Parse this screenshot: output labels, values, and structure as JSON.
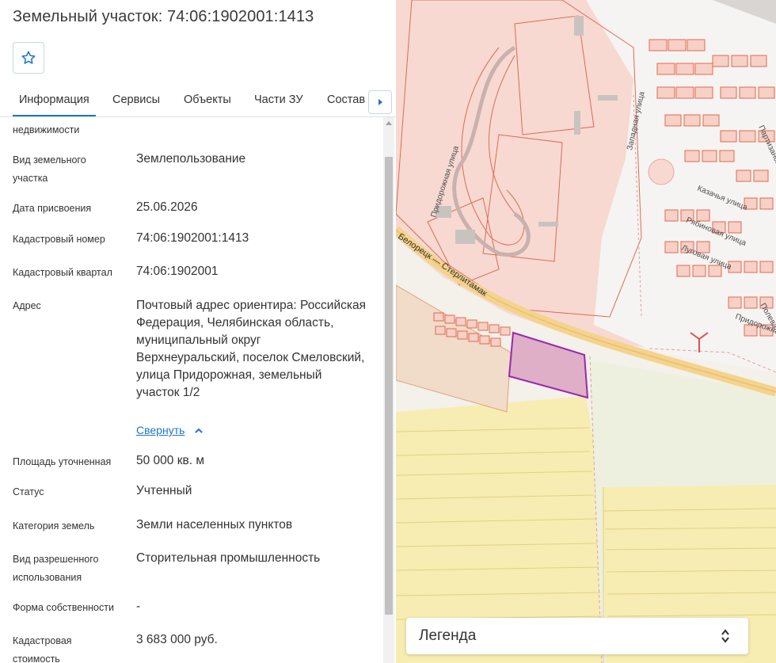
{
  "panel": {
    "title": "Земельный участок: 74:06:1902001:1413",
    "favorite_icon": "star-outline-icon",
    "tabs": [
      "Информация",
      "Сервисы",
      "Объекты",
      "Части ЗУ",
      "Состав"
    ],
    "active_tab": "Информация",
    "tab_scroll_icon": "chevron-right-icon",
    "rows": [
      {
        "label": "недвижимости",
        "value": ""
      },
      {
        "label": "Вид земельного участка",
        "value": "Землепользование"
      },
      {
        "label": "Дата присвоения",
        "value": "25.06.2026"
      },
      {
        "label": "Кадастровый номер",
        "value": "74:06:1902001:1413"
      },
      {
        "label": "Кадастровый квартал",
        "value": "74:06:1902001"
      },
      {
        "label": "Адрес",
        "value": "Почтовый адрес ориентира: Российская Федерация, Челябинская область, муниципальный округ Верхнеуральский, поселок Смеловский, улица Придорожная, земельный участок 1/2"
      },
      {
        "label": "Площадь уточненная",
        "value": "50 000 кв. м"
      },
      {
        "label": "Статус",
        "value": "Учтенный"
      },
      {
        "label": "Категория земель",
        "value": "Земли населенных пунктов"
      },
      {
        "label": "Вид разрешенного использования",
        "value": "Сторительная промышленность"
      },
      {
        "label": "Форма собственности",
        "value": "-"
      },
      {
        "label": "Кадастровая стоимость",
        "value": "3 683 000 руб."
      }
    ],
    "collapse_link": "Свернуть"
  },
  "map": {
    "streets": [
      "Придорожная улица",
      "Западная улица",
      "Казачья улица",
      "Рябиновая улица",
      "Луговая улица",
      "Партизанская",
      "Полевая",
      "Придорожная",
      "Белорецк — Стерлитамак"
    ],
    "colors": {
      "built_zone": "#f7d9d2",
      "parcel_outline": "#e06a50",
      "highlighted_parcel_fill": "#d9a3bf",
      "highlighted_parcel_outline": "#9c27b0",
      "road": "#f4d38e",
      "field": "#f7edb2"
    }
  },
  "legend": {
    "label": "Легенда",
    "icon": "sort-updown-icon"
  }
}
